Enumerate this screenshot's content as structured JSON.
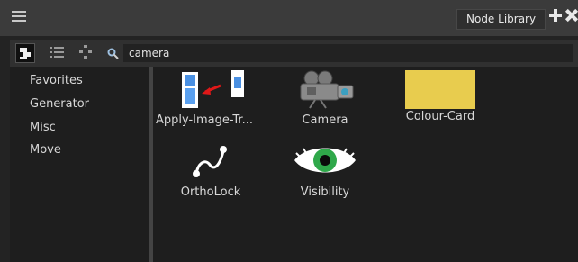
{
  "panel": {
    "menu_icon": "hamburger-menu-icon",
    "tab_label": "Node Library",
    "add_icon": "plus-icon",
    "close_icon": "close-icon"
  },
  "toolbar": {
    "view_tools": [
      "single-view-icon",
      "list-view-icon",
      "tree-view-icon"
    ],
    "search_icon": "magnifier-icon",
    "search_value": "camera"
  },
  "categories": [
    "Favorites",
    "Generator",
    "Misc",
    "Move"
  ],
  "nodes": [
    {
      "label": "Apply-Image-Tr...",
      "icon": "apply-image-transform-icon"
    },
    {
      "label": "Camera",
      "icon": "camera-icon"
    },
    {
      "label": "Colour-Card",
      "icon": "colour-card-icon",
      "color": "#e8cc4e"
    },
    {
      "label": "OrthoLock",
      "icon": "ortholock-curve-icon"
    },
    {
      "label": "Visibility",
      "icon": "eye-icon"
    }
  ]
}
